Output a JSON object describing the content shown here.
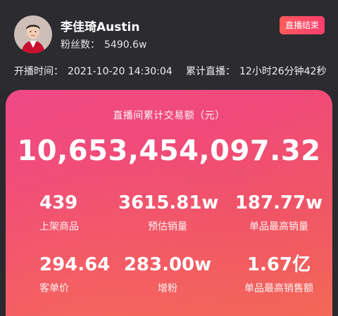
{
  "streamer": {
    "name": "李佳琦Austin",
    "fans_label": "粉丝数：",
    "fans_value": "5490.6w"
  },
  "end_button": "直播结束",
  "start_time": {
    "label": "开播时间：",
    "value": "2021-10-20 14:30:04"
  },
  "duration": {
    "label": "累计直播：",
    "value": "12小时26分钟42秒"
  },
  "total": {
    "label": "直播间累计交易额（元）",
    "value": "10,653,454,097.32"
  },
  "stats": [
    {
      "value": "439",
      "label": "上架商品"
    },
    {
      "value": "3615.81w",
      "label": "预估销量"
    },
    {
      "value": "187.77w",
      "label": "单品最高销量"
    },
    {
      "value": "294.64",
      "label": "客单价"
    },
    {
      "value": "283.00w",
      "label": "增粉"
    },
    {
      "value": "1.67亿",
      "label": "单品最高销售额"
    }
  ],
  "colors": {
    "header_bg": "#2b2b30",
    "card_gradient_start": "#f04a86",
    "card_gradient_end": "#f36a55",
    "end_button_bg": "#ff4b5e"
  }
}
